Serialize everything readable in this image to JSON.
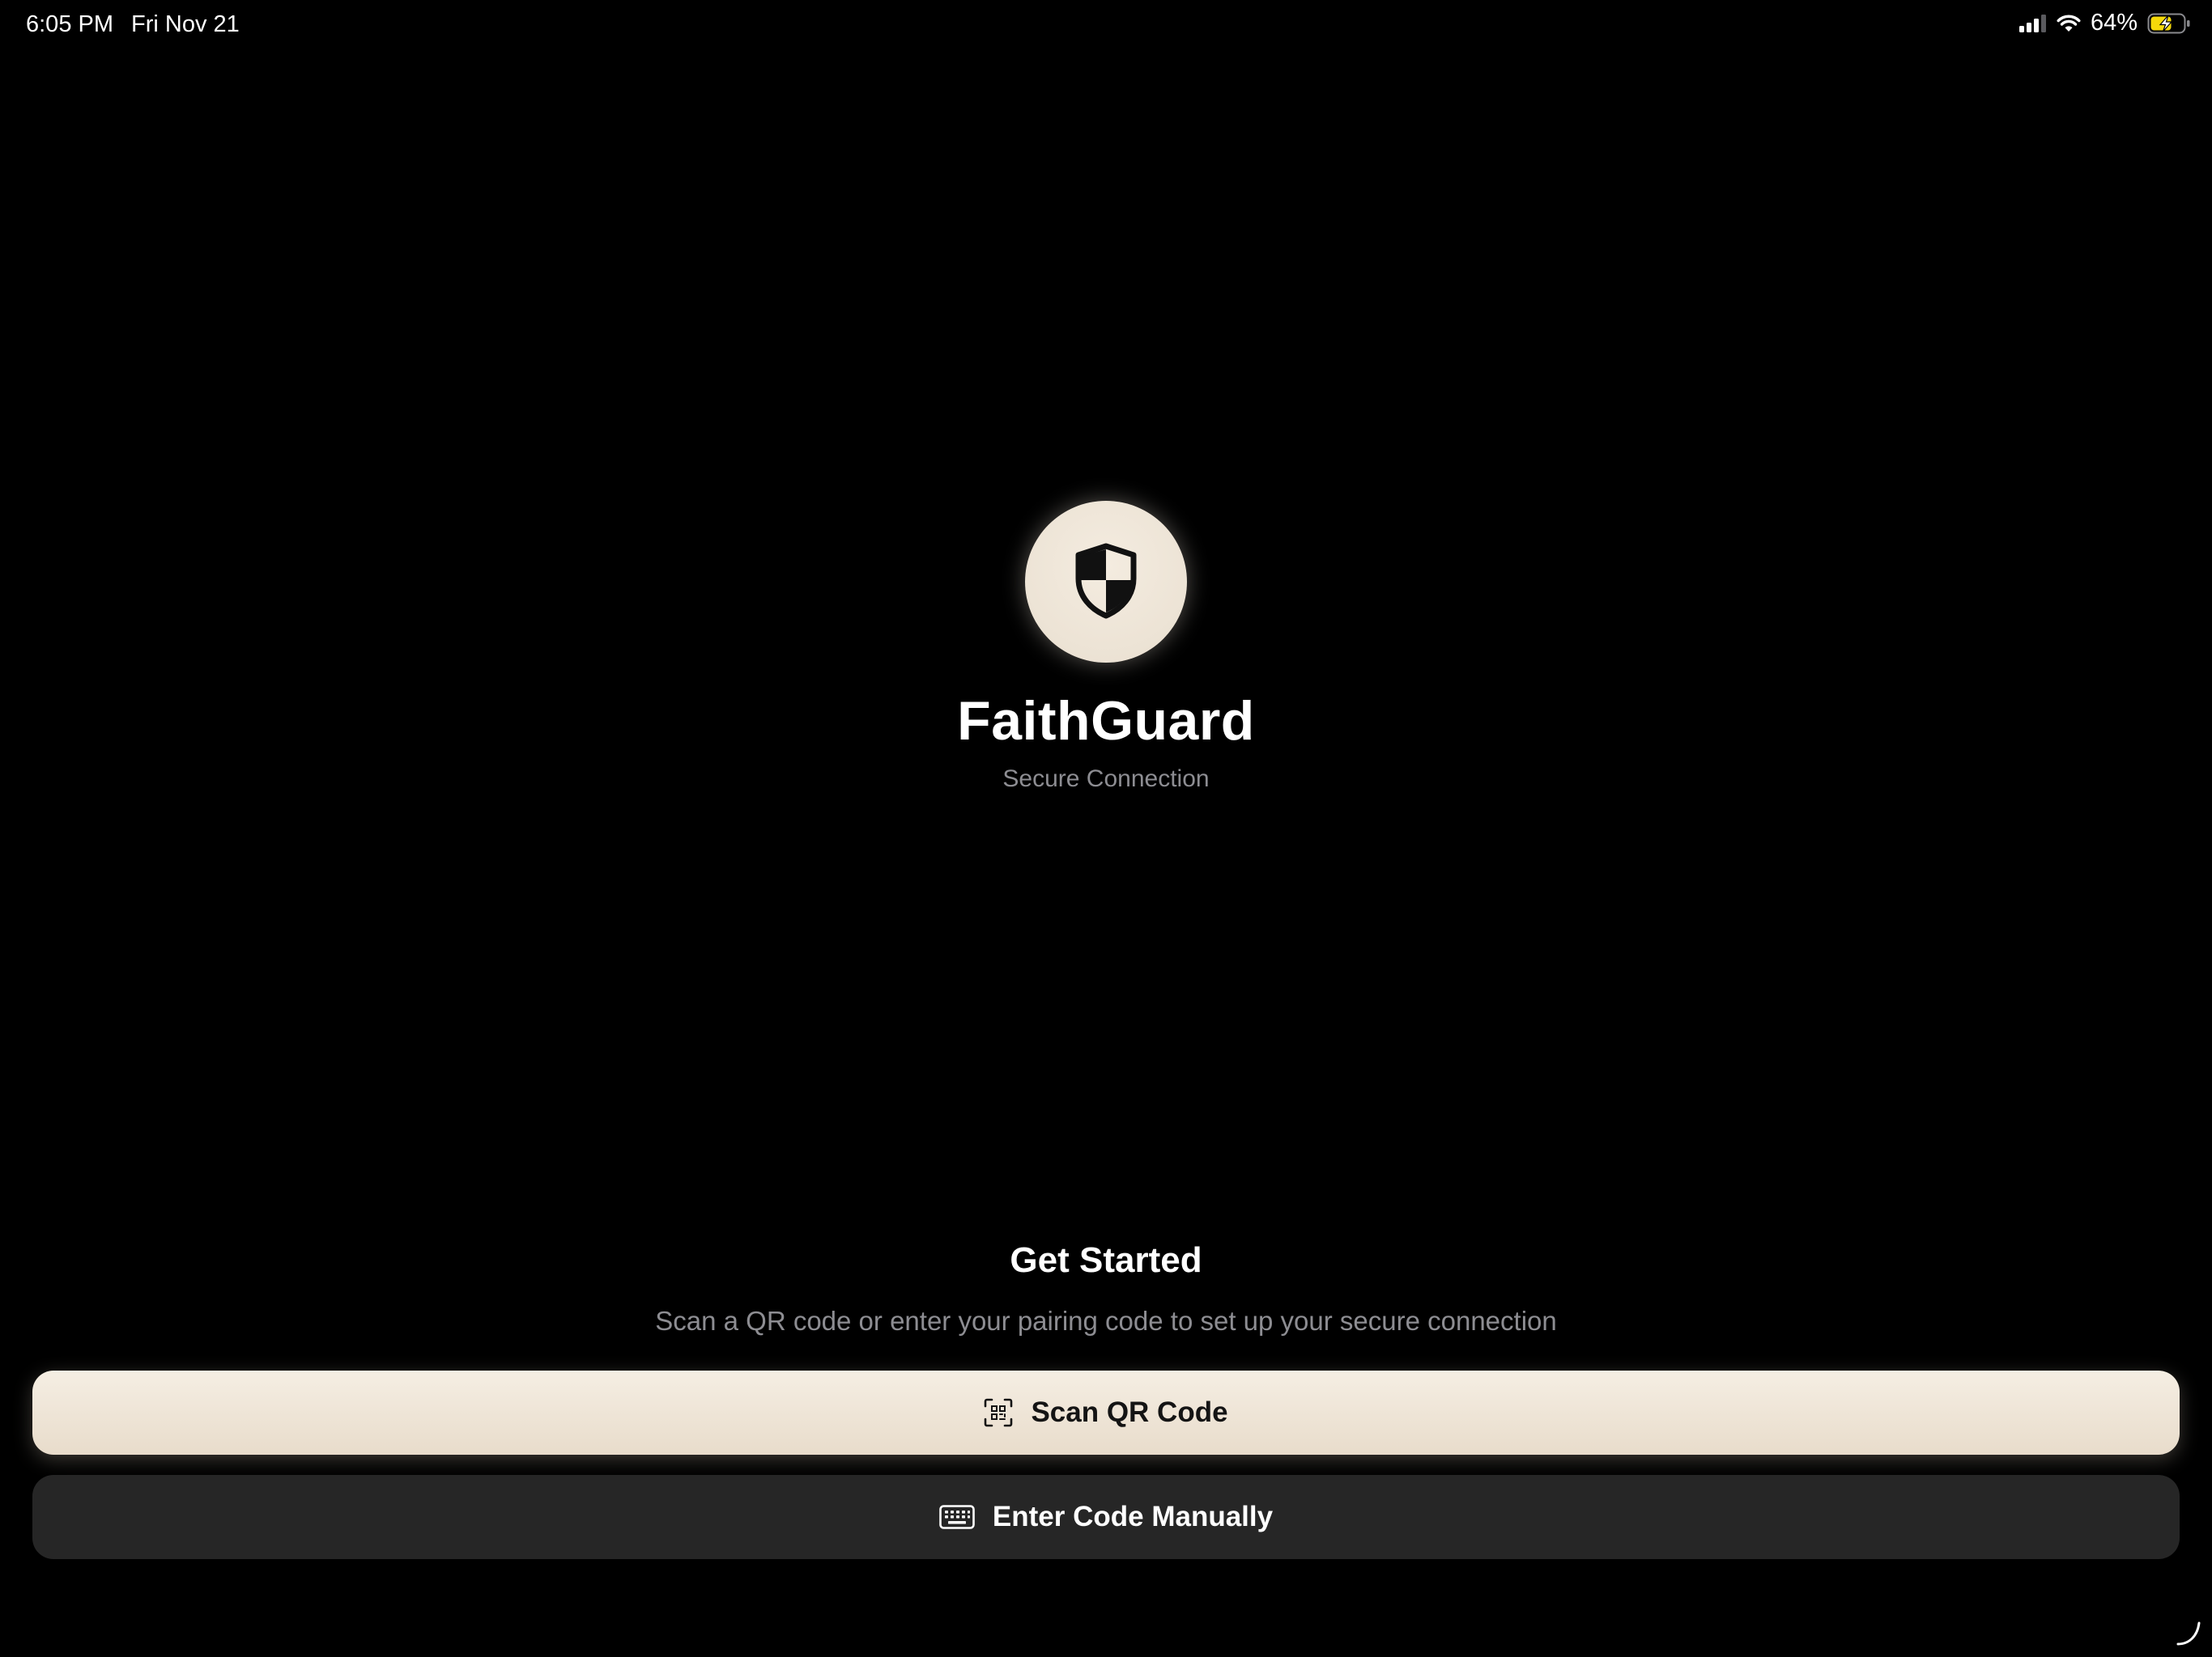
{
  "status_bar": {
    "time": "6:05 PM",
    "date": "Fri Nov 21",
    "battery_percent": "64%",
    "battery_level": 0.64,
    "battery_charging": true,
    "signal_icon": "cellular-signal-icon",
    "wifi_icon": "wifi-icon",
    "battery_icon": "battery-charging-icon"
  },
  "app": {
    "name": "FaithGuard",
    "subtitle": "Secure Connection",
    "logo_icon": "shield-icon"
  },
  "get_started": {
    "title": "Get Started",
    "description": "Scan a QR code or enter your pairing code to set up your secure connection"
  },
  "actions": {
    "scan_label": "Scan QR Code",
    "scan_icon": "qr-code-scan-icon",
    "manual_label": "Enter Code Manually",
    "manual_icon": "keyboard-icon"
  },
  "colors": {
    "background": "#000000",
    "primary_button": "#f2eadd",
    "secondary_button": "#262626",
    "muted_text": "#8d8d92",
    "battery_charging": "#f5d90a"
  }
}
